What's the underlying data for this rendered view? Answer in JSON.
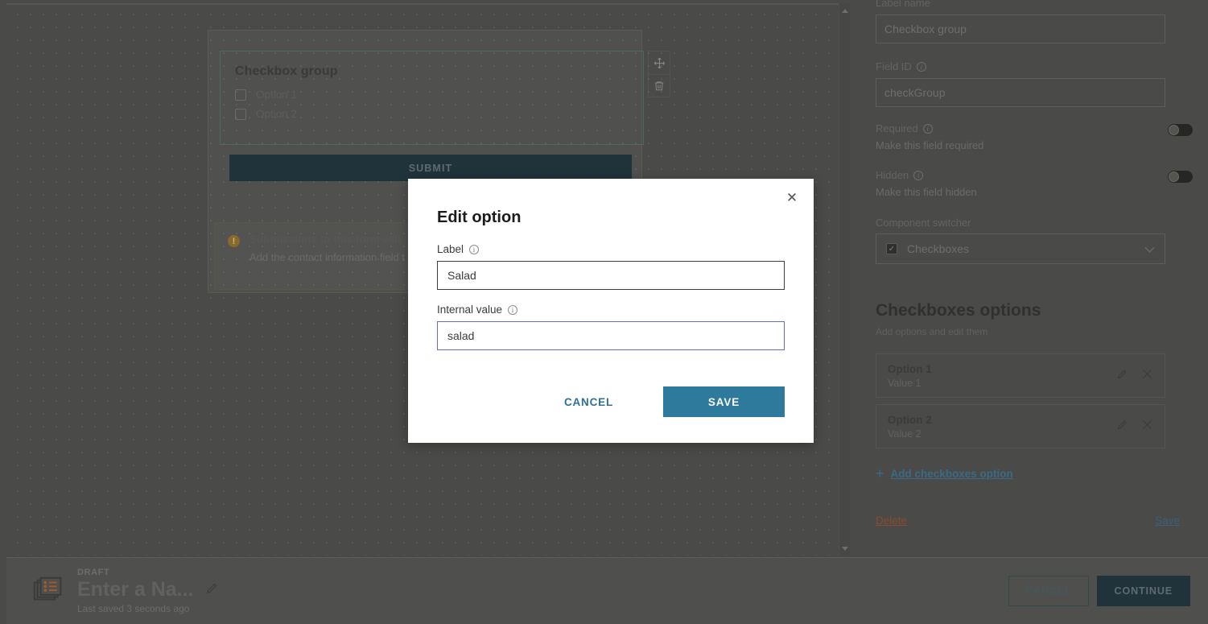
{
  "canvas": {
    "form_field": {
      "title": "Checkbox group",
      "options": [
        {
          "label": "Option 1"
        },
        {
          "label": "Option 2"
        }
      ]
    },
    "submit_label": "SUBMIT",
    "notice": {
      "title": "Submissions to this form will n",
      "body": "Add the contact information field t form is submitted."
    },
    "tools": {
      "move": "move-icon",
      "delete": "trash-icon"
    }
  },
  "panel": {
    "label_name_label": "Label name",
    "label_name_value": "Checkbox group",
    "field_id_label": "Field ID",
    "field_id_value": "checkGroup",
    "required_label": "Required",
    "required_sub": "Make this field required",
    "required_on": false,
    "hidden_label": "Hidden",
    "hidden_sub": "Make this field hidden",
    "hidden_on": false,
    "switcher_label": "Component switcher",
    "switcher_value": "Checkboxes",
    "options_heading": "Checkboxes options",
    "options_subheading": "Add options and edit them",
    "options": [
      {
        "name": "Option 1",
        "value": "Value 1"
      },
      {
        "name": "Option 2",
        "value": "Value 2"
      }
    ],
    "add_option_label": "Add checkboxes option",
    "delete_label": "Delete",
    "save_label": "Save"
  },
  "modal": {
    "title": "Edit option",
    "close_icon": "✕",
    "label_field_label": "Label",
    "label_field_value": "Salad",
    "internal_field_label": "Internal value",
    "internal_field_value": "salad",
    "cancel_label": "CANCEL",
    "save_label": "SAVE",
    "save_color": "#2e7a9c"
  },
  "bottombar": {
    "status": "DRAFT",
    "title": "Enter a Na...",
    "saved_text": "Last saved 3 seconds ago",
    "edit_icon": "pencil-icon",
    "cancel_label": "CANCEL",
    "continue_label": "CONTINUE"
  }
}
